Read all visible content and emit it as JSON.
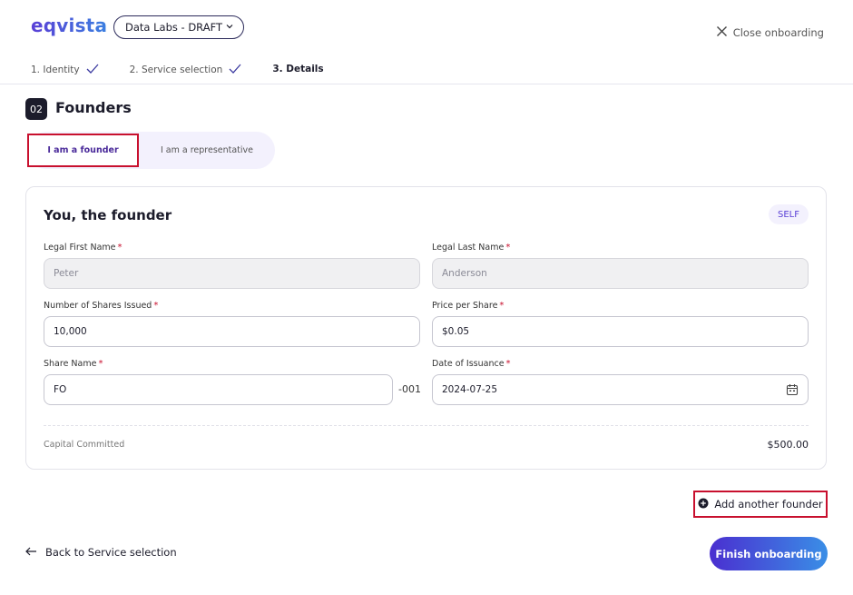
{
  "brand": {
    "logo": "eqvista"
  },
  "company_select": {
    "value": "Data Labs - DRAFT"
  },
  "close": {
    "label": "Close onboarding"
  },
  "steps": [
    {
      "label": "1. Identity",
      "done": true
    },
    {
      "label": "2. Service selection",
      "done": true
    },
    {
      "label": "3. Details",
      "done": false
    }
  ],
  "section": {
    "number": "02",
    "title": "Founders"
  },
  "role_toggle": {
    "selected": "I am a founder",
    "other": "I am a representative"
  },
  "card": {
    "title": "You, the founder",
    "badge": "SELF",
    "first_name": {
      "label": "Legal First Name",
      "required": "*",
      "value": "Peter"
    },
    "last_name": {
      "label": "Legal Last Name",
      "required": "*",
      "value": "Anderson"
    },
    "shares": {
      "label": "Number of Shares Issued",
      "required": "*",
      "value": "10,000"
    },
    "price": {
      "label": "Price per Share",
      "required": "*",
      "value": "$0.05"
    },
    "share_name": {
      "label": "Share Name",
      "required": "*",
      "value": "FO",
      "suffix": "-001"
    },
    "date": {
      "label": "Date of Issuance",
      "required": "*",
      "value": "2024-07-25",
      "icon": "calendar-icon"
    },
    "capital": {
      "label": "Capital Committed",
      "value": "$500.00"
    }
  },
  "actions": {
    "add_founder": "Add another founder",
    "back": "Back to Service selection",
    "finish": "Finish onboarding"
  },
  "colors": {
    "accent": "#5a3fd6",
    "highlight": "#c8102e",
    "dark": "#1c1c2b"
  }
}
